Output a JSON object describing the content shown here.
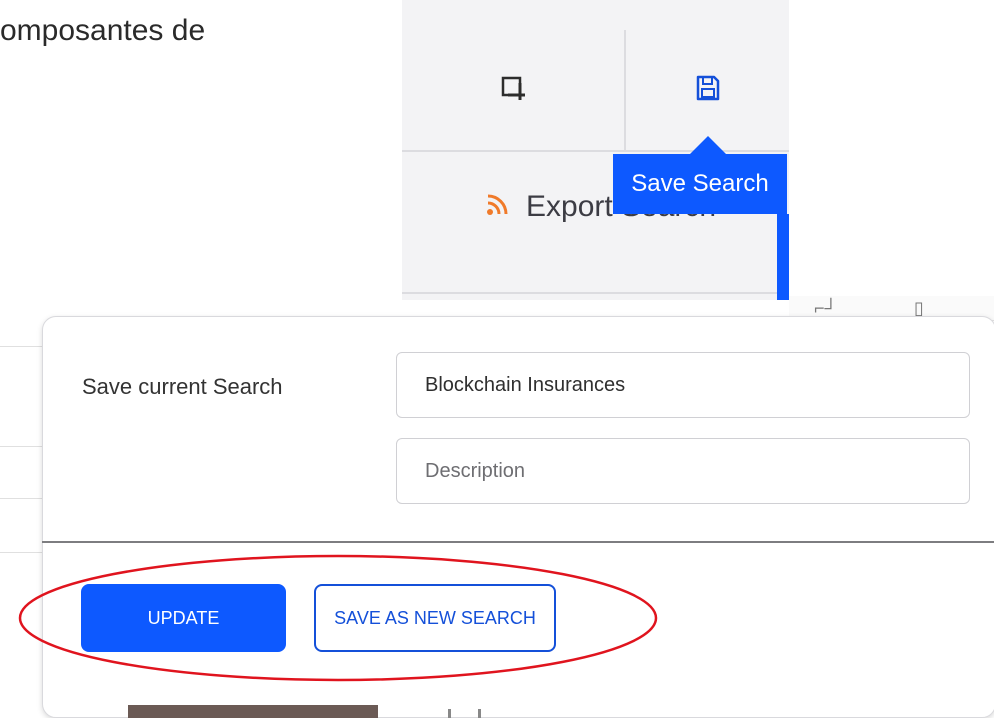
{
  "heading_fragment": "omposantes de",
  "toolbar": {
    "crop_icon": "crop-icon",
    "save_icon": "floppy-save-icon",
    "export_label": "Export Search",
    "export_icon": "rss-icon",
    "tooltip": "Save Search"
  },
  "dialog": {
    "label": "Save current Search",
    "name_value": "Blockchain Insurances",
    "description_placeholder": "Description",
    "update_label": "UPDATE",
    "save_new_label": "SAVE AS NEW SEARCH"
  },
  "colors": {
    "accent": "#0d59ff",
    "annotation": "#e0141e",
    "rss": "#f07a2a"
  }
}
